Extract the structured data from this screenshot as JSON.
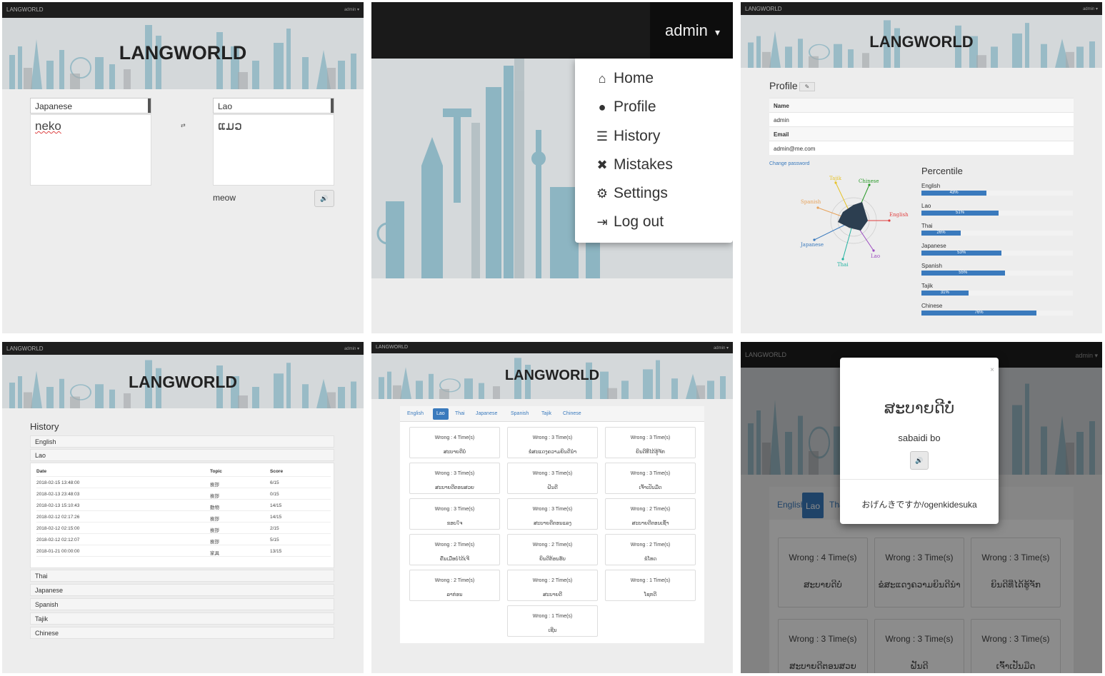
{
  "app": {
    "brand": "LANGWORLD",
    "admin_small": "admin ▾",
    "logo": "LANGWORLD"
  },
  "translate": {
    "source_lang": "Japanese",
    "target_lang": "Lao",
    "source_text": "neko",
    "target_text": "ແມວ",
    "swap_icon": "⇄",
    "meaning": "meow",
    "audio_icon": "speaker-icon",
    "audio_glyph": "🔊"
  },
  "menu": {
    "admin_label": "admin",
    "caret": "▾",
    "items": [
      {
        "label": "Home",
        "icon": "home-icon",
        "glyph": "⌂"
      },
      {
        "label": "Profile",
        "icon": "user-icon",
        "glyph": "●"
      },
      {
        "label": "History",
        "icon": "list-icon",
        "glyph": "☰"
      },
      {
        "label": "Mistakes",
        "icon": "x-icon",
        "glyph": "✖"
      },
      {
        "label": "Settings",
        "icon": "gear-icon",
        "glyph": "⚙"
      },
      {
        "label": "Log out",
        "icon": "logout-icon",
        "glyph": "⇥"
      }
    ]
  },
  "profile": {
    "title": "Profile",
    "edit_glyph": "✎",
    "name_label": "Name",
    "name_value": "admin",
    "email_label": "Email",
    "email_value": "admin@me.com",
    "change_password": "Change password",
    "radar_labels": [
      "Tajik",
      "Chinese",
      "Spanish",
      "English",
      "Japanese",
      "Thai",
      "Lao"
    ],
    "percentile_title": "Percentile",
    "percentiles": [
      {
        "lang": "English",
        "value": 43,
        "label": "43%"
      },
      {
        "lang": "Lao",
        "value": 51,
        "label": "51%"
      },
      {
        "lang": "Thai",
        "value": 26,
        "label": "26%"
      },
      {
        "lang": "Japanese",
        "value": 53,
        "label": "53%"
      },
      {
        "lang": "Spanish",
        "value": 55,
        "label": "55%"
      },
      {
        "lang": "Tajik",
        "value": 31,
        "label": "31%"
      },
      {
        "lang": "Chinese",
        "value": 76,
        "label": "76%"
      }
    ]
  },
  "history": {
    "title": "History",
    "open_lang": "Lao",
    "top_langs": [
      "English",
      "Lao"
    ],
    "bottom_langs": [
      "Thai",
      "Japanese",
      "Spanish",
      "Tajik",
      "Chinese"
    ],
    "columns": [
      "Date",
      "Topic",
      "Score"
    ],
    "rows": [
      {
        "date": "2018-02-15 13:48:00",
        "topic": "挨拶",
        "score": "6/15"
      },
      {
        "date": "2018-02-13 23:48:03",
        "topic": "挨拶",
        "score": "0/15"
      },
      {
        "date": "2018-02-13 15:10:43",
        "topic": "動物",
        "score": "14/15"
      },
      {
        "date": "2018-02-12 02:17:26",
        "topic": "挨拶",
        "score": "14/15"
      },
      {
        "date": "2018-02-12 02:15:00",
        "topic": "挨拶",
        "score": "2/15"
      },
      {
        "date": "2018-02-12 02:12:07",
        "topic": "挨拶",
        "score": "5/15"
      },
      {
        "date": "2018-01-21 00:00:00",
        "topic": "家具",
        "score": "13/15"
      }
    ]
  },
  "mistakes": {
    "tabs": [
      "English",
      "Lao",
      "Thai",
      "Japanese",
      "Spanish",
      "Tajik",
      "Chinese"
    ],
    "active_tab": "Lao",
    "cards": [
      {
        "wrong": "Wrong : 4 Time(s)",
        "text": "ສະບາຍດີບໍ່"
      },
      {
        "wrong": "Wrong : 3 Time(s)",
        "text": "ຂໍສະແດງຄວາມຍິນດີນຳ"
      },
      {
        "wrong": "Wrong : 3 Time(s)",
        "text": "ຍິນດີທີ່ໄດ້ຮູ້ຈັກ"
      },
      {
        "wrong": "Wrong : 3 Time(s)",
        "text": "ສະບາຍດີຕອນສວຍ"
      },
      {
        "wrong": "Wrong : 3 Time(s)",
        "text": "ຝັນດີ"
      },
      {
        "wrong": "Wrong : 3 Time(s)",
        "text": "ເຈົ້າເປັນມືດ"
      },
      {
        "wrong": "Wrong : 3 Time(s)",
        "text": "ຂອບໃຈ"
      },
      {
        "wrong": "Wrong : 3 Time(s)",
        "text": "ສະບາຍດີຕອນແລງ"
      },
      {
        "wrong": "Wrong : 2 Time(s)",
        "text": "ສະບາຍດີຕອນເຊົ້າ"
      },
      {
        "wrong": "Wrong : 2 Time(s)",
        "text": "ຄືນເມືອບໍ່ໄດ້ເຈີ"
      },
      {
        "wrong": "Wrong : 2 Time(s)",
        "text": "ຍິນດີຕ້ອນຮັບ"
      },
      {
        "wrong": "Wrong : 2 Time(s)",
        "text": "ຂໍໂທດ"
      },
      {
        "wrong": "Wrong : 2 Time(s)",
        "text": "ລາກ່ອນ"
      },
      {
        "wrong": "Wrong : 2 Time(s)",
        "text": "ສະບາຍດີ"
      },
      {
        "wrong": "Wrong : 1 Time(s)",
        "text": "ໂຊກດີ"
      },
      {
        "wrong": "Wrong : 1 Time(s)",
        "text": "ເຊີນ"
      }
    ]
  },
  "modal": {
    "close": "×",
    "word": "ສະບາຍດີບໍ່",
    "romanized": "sabaidi bo",
    "audio_glyph": "🔊",
    "meaning": "おげんきですか/ogenkidesuka",
    "bg_tabs": [
      "English",
      "Lao",
      "Thai"
    ],
    "bg_cards": [
      {
        "wrong": "Wrong : 4 Time(s)",
        "text": "ສະບາຍດີບໍ່"
      },
      {
        "wrong": "Wrong : 3 Time(s)",
        "text": "ຂໍສະແດງຄວາມຍິນດີນຳ"
      },
      {
        "wrong": "Wrong : 3 Time(s)",
        "text": "ຍິນດີທີ່ໄດ້ຮູ້ຈັກ"
      },
      {
        "wrong": "Wrong : 3 Time(s)",
        "text": "ສະບາຍດີຕອນສວຍ"
      },
      {
        "wrong": "Wrong : 3 Time(s)",
        "text": "ຝັນດີ"
      },
      {
        "wrong": "Wrong : 3 Time(s)",
        "text": "ເຈົ້າເປັນມືດ"
      }
    ]
  }
}
